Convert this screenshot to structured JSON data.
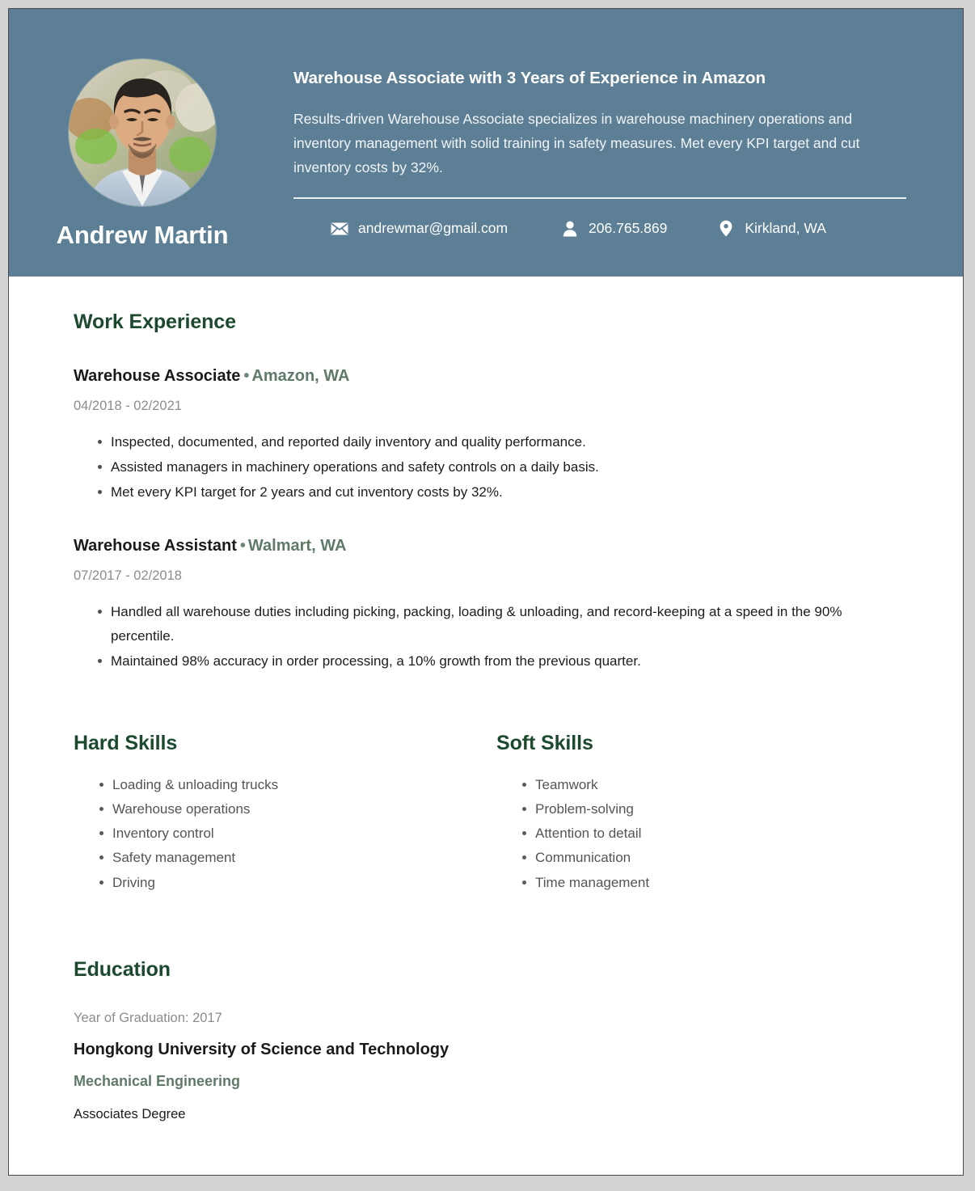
{
  "theme": {
    "header_bg": "#5d7f95",
    "heading_green": "#1d4a2e",
    "accent_sage": "#5f7a68",
    "muted_gray": "#8c8c8c",
    "page_bg": "#ffffff",
    "outer_bg": "#d3d3d3"
  },
  "header": {
    "full_name": "Andrew Martin",
    "headline": "Warehouse Associate with 3 Years of Experience in Amazon",
    "summary": "Results-driven Warehouse Associate specializes in warehouse machinery operations and inventory management with solid training in safety measures. Met every KPI target and cut inventory costs by 32%.",
    "avatar_alt": "Profile photo",
    "contacts": [
      {
        "icon": "envelope-icon",
        "value": "andrewmar@gmail.com",
        "type": "email"
      },
      {
        "icon": "person-icon",
        "value": "206.765.869",
        "type": "phone"
      },
      {
        "icon": "location-pin-icon",
        "value": "Kirkland, WA",
        "type": "location"
      }
    ]
  },
  "work_experience": {
    "title": "Work Experience",
    "jobs": [
      {
        "position": "Warehouse Associate",
        "separator": "•",
        "company": "Amazon, WA",
        "dates": "04/2018 - 02/2021",
        "bullets": [
          "Inspected, documented, and reported daily inventory and quality performance.",
          "Assisted managers in machinery operations and safety controls on a daily basis.",
          "Met every KPI target for 2 years and cut inventory costs by 32%."
        ]
      },
      {
        "position": "Warehouse Assistant",
        "separator": "•",
        "company": "Walmart, WA",
        "dates": "07/2017 - 02/2018",
        "bullets": [
          "Handled all warehouse duties including picking, packing, loading & unloading, and record-keeping at a speed in the 90% percentile.",
          "Maintained 98% accuracy in order processing, a 10% growth from the previous quarter."
        ]
      }
    ]
  },
  "hard_skills": {
    "title": "Hard Skills",
    "items": [
      "Loading & unloading trucks",
      "Warehouse operations",
      "Inventory control",
      "Safety management",
      "Driving"
    ]
  },
  "soft_skills": {
    "title": "Soft Skills",
    "items": [
      "Teamwork",
      "Problem-solving",
      "Attention to detail",
      "Communication",
      "Time management"
    ]
  },
  "education": {
    "title": "Education",
    "year_of_graduation": "Year of Graduation: 2017",
    "school": "Hongkong University of Science and Technology",
    "major": "Mechanical Engineering",
    "degree": "Associates Degree"
  }
}
